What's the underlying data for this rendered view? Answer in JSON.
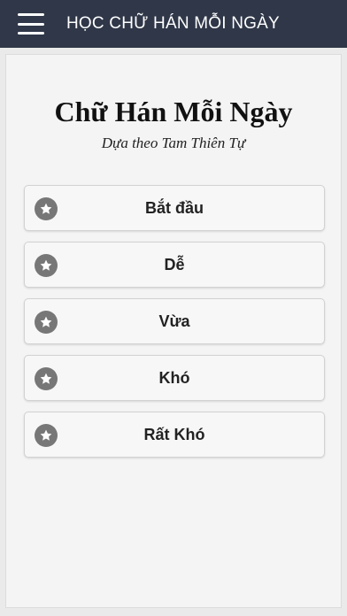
{
  "header": {
    "menu_icon": "hamburger-menu-icon",
    "title": "HỌC CHỮ HÁN MỖI NGÀY",
    "background_color": "#2f3748"
  },
  "main": {
    "heading": "Chữ Hán Mỗi Ngày",
    "subheading": "Dựa theo Tam Thiên Tự",
    "levels": [
      {
        "label": "Bắt đầu",
        "icon": "star-icon"
      },
      {
        "label": "Dễ",
        "icon": "star-icon"
      },
      {
        "label": "Vừa",
        "icon": "star-icon"
      },
      {
        "label": "Khó",
        "icon": "star-icon"
      },
      {
        "label": "Rất Khó",
        "icon": "star-icon"
      }
    ]
  }
}
